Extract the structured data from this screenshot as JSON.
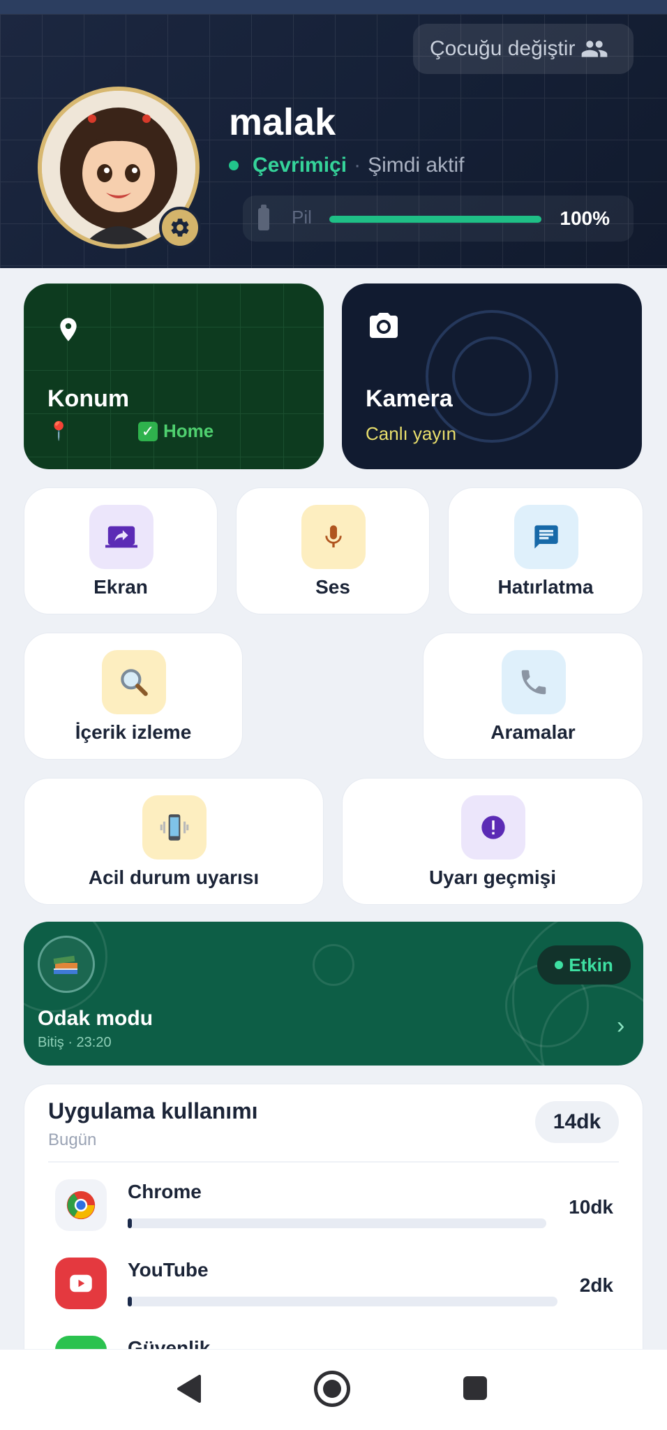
{
  "header": {
    "switch_child_label": "Çocuğu değiştir",
    "child_name": "malak",
    "status_online": "Çevrimiçi",
    "status_separator": "·",
    "status_active": "Şimdi aktif",
    "battery_label": "Pil",
    "battery_value": "100%",
    "battery_fraction": 1.0
  },
  "cards": {
    "location": {
      "title": "Konum",
      "home_label": "Home"
    },
    "camera": {
      "title": "Kamera",
      "subtitle": "Canlı yayın"
    },
    "screen": {
      "label": "Ekran"
    },
    "sound": {
      "label": "Ses"
    },
    "reminder": {
      "label": "Hatırlatma"
    },
    "content": {
      "label": "İçerik izleme"
    },
    "calls": {
      "label": "Aramalar"
    },
    "emergency": {
      "label": "Acil durum uyarısı"
    },
    "alert_history": {
      "label": "Uyarı geçmişi"
    }
  },
  "focus_mode": {
    "title": "Odak modu",
    "subtitle": "Bitiş · 23:20",
    "badge": "Etkin",
    "chevron": "›"
  },
  "usage": {
    "title": "Uygulama kullanımı",
    "subtitle": "Bugün",
    "total": "14dk",
    "apps": [
      {
        "name": "Chrome",
        "time": "10dk",
        "fraction": 0.01
      },
      {
        "name": "YouTube",
        "time": "2dk",
        "fraction": 0.01
      },
      {
        "name": "Güvenlik",
        "time": "",
        "fraction": 0
      }
    ]
  },
  "colors": {
    "accent_green": "#22c58b",
    "header_bg": "#152036",
    "focus_bg": "#0d5e46",
    "location_bg": "#0d3b1f",
    "camera_bg": "#111b30",
    "camera_subtitle": "#e9df6c"
  },
  "icons": {
    "switch": "people-icon",
    "settings": "gear-icon",
    "location": "map-pin-icon",
    "camera": "camera-icon",
    "screen": "screen-share-icon",
    "sound": "microphone-icon",
    "reminder": "message-icon",
    "content": "magnifier-icon",
    "calls": "phone-icon",
    "emergency": "vibrating-phone-icon",
    "alert_history": "exclamation-icon",
    "focus": "books-icon"
  }
}
